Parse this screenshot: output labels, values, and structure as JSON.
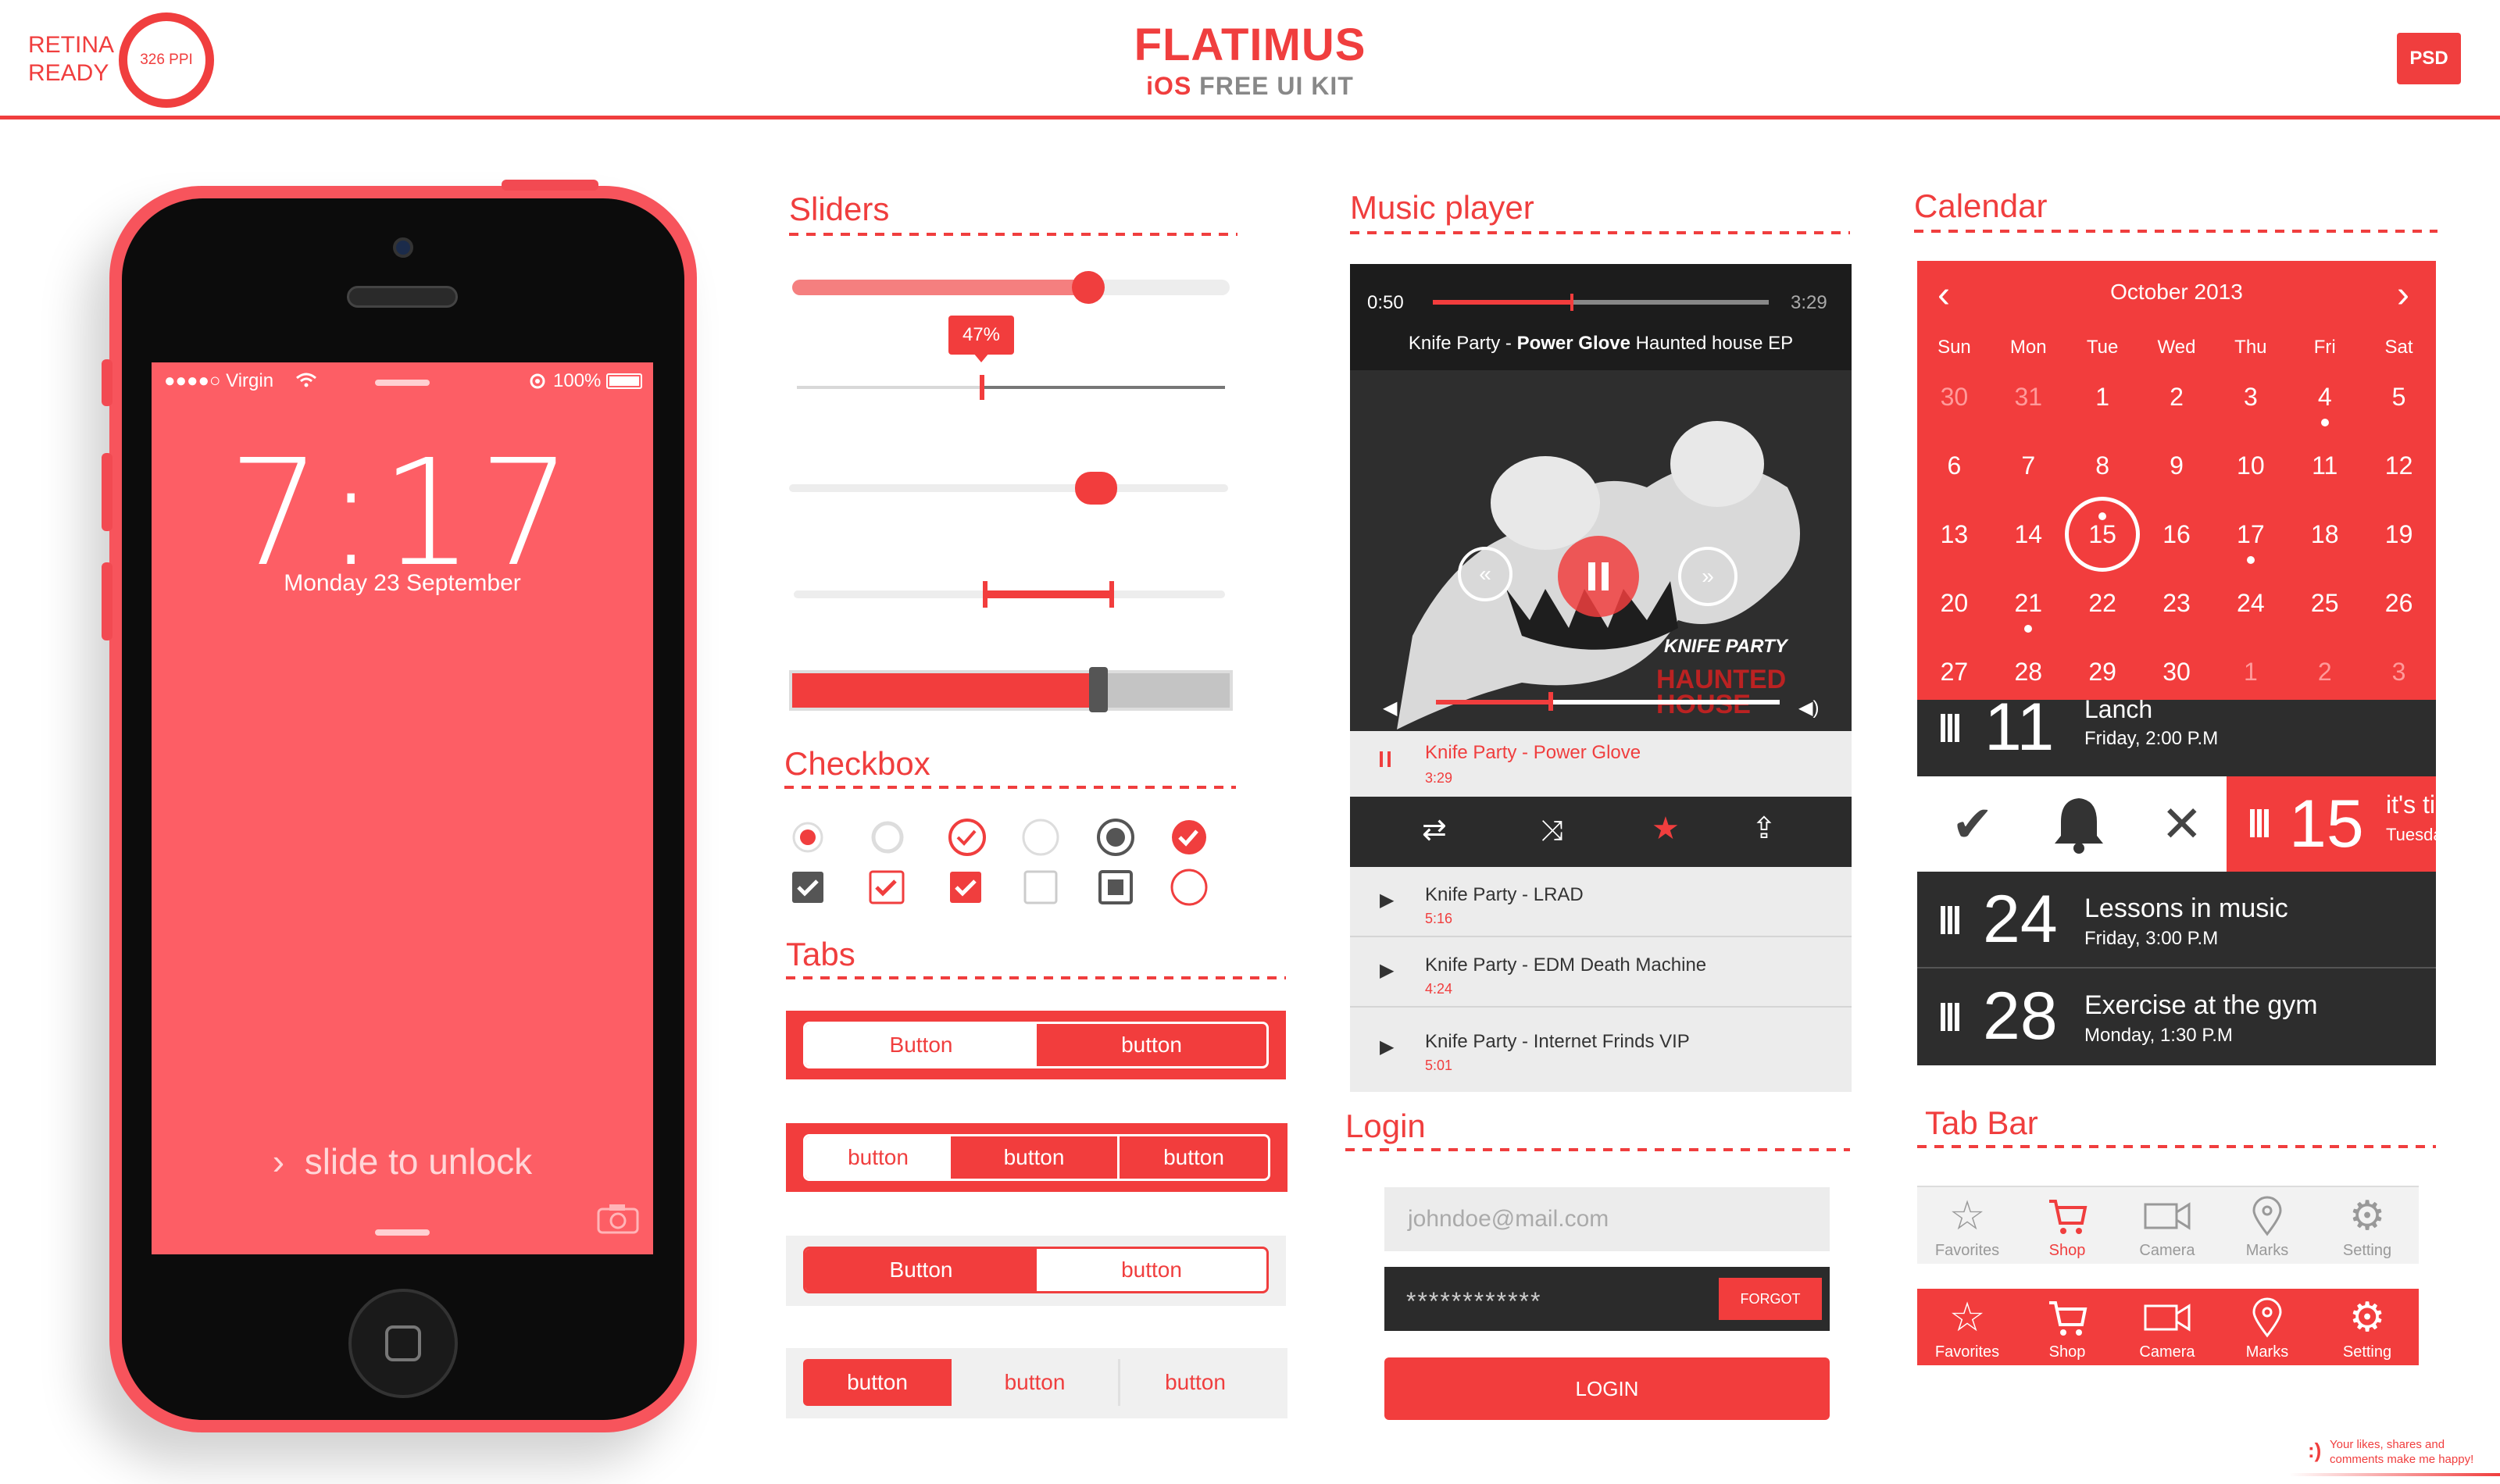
{
  "header": {
    "retina_line1": "RETINA",
    "retina_line2": "READY",
    "ppi": "326 PPI",
    "title": "FLATIMUS",
    "subtitle_ios": "iOS",
    "subtitle_rest": "FREE UI KIT",
    "psd": "PSD"
  },
  "phone": {
    "carrier": "●●●●○ Virgin",
    "battery": "100%",
    "time": "7:17",
    "date": "Monday 23 September",
    "unlock": "slide to unlock"
  },
  "sliders": {
    "title": "Sliders",
    "tooltip": "47%"
  },
  "checkbox": {
    "title": "Checkbox"
  },
  "tabs": {
    "title": "Tabs",
    "row1": [
      "Button",
      "button"
    ],
    "row2": [
      "button",
      "button",
      "button"
    ],
    "row3": [
      "Button",
      "button"
    ],
    "row4": [
      "button",
      "button",
      "button"
    ]
  },
  "music": {
    "title": "Music player",
    "time_elapsed": "0:50",
    "time_total": "3:29",
    "artist": "Knife Party - ",
    "song": "Power Glove",
    "album": " Haunted house EP",
    "album_art_brand": "KNIFE PARTY",
    "album_art_title": "HAUNTED HOUSE",
    "now_playing": {
      "name": "Knife Party - Power Glove",
      "duration": "3:29"
    },
    "tracks": [
      {
        "name": "Knife Party - LRAD",
        "duration": "5:16"
      },
      {
        "name": "Knife Party - EDM Death Machine",
        "duration": "4:24"
      },
      {
        "name": "Knife Party - Internet Frinds VIP",
        "duration": "5:01"
      }
    ]
  },
  "login": {
    "title": "Login",
    "email_placeholder": "johndoe@mail.com",
    "password_value": "************",
    "forgot": "FORGOT",
    "login_button": "LOGIN"
  },
  "calendar": {
    "title": "Calendar",
    "month": "October 2013",
    "weekdays": [
      "Sun",
      "Mon",
      "Tue",
      "Wed",
      "Thu",
      "Fri",
      "Sat"
    ],
    "weeks": [
      [
        "30",
        "31",
        "1",
        "2",
        "3",
        "4",
        "5"
      ],
      [
        "6",
        "7",
        "8",
        "9",
        "10",
        "11",
        "12"
      ],
      [
        "13",
        "14",
        "15",
        "16",
        "17",
        "18",
        "19"
      ],
      [
        "20",
        "21",
        "22",
        "23",
        "24",
        "25",
        "26"
      ],
      [
        "27",
        "28",
        "29",
        "30",
        "1",
        "2",
        "3"
      ]
    ],
    "selected_day": "15",
    "events": [
      {
        "day": "11",
        "name": "Lanch",
        "when": "Friday, 2:00 P.M"
      },
      {
        "day": "15",
        "name": "it's ti",
        "when": "Tuesda"
      },
      {
        "day": "24",
        "name": "Lessons in music",
        "when": "Friday, 3:00 P.M"
      },
      {
        "day": "28",
        "name": "Exercise at the gym",
        "when": "Monday, 1:30 P.M"
      }
    ]
  },
  "tabbar": {
    "title": "Tab Bar",
    "items": [
      "Favorites",
      "Shop",
      "Camera",
      "Marks",
      "Setting"
    ]
  },
  "footer": {
    "smiley": ":)",
    "line1": "Your likes, shares and",
    "line2": "comments make me happy!"
  }
}
